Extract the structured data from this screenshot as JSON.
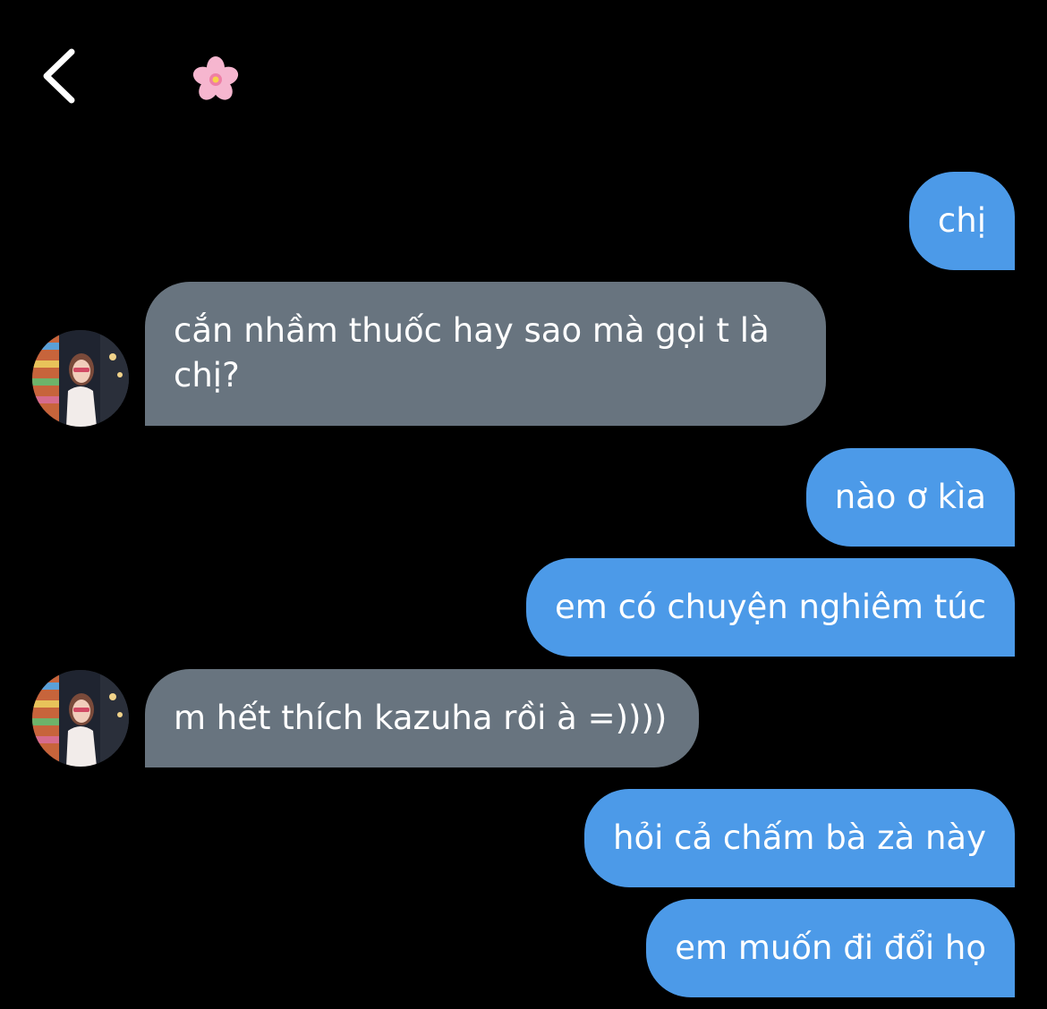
{
  "header": {
    "back_icon": "chevron-left-icon",
    "contact_icon": "cherry-blossom-icon"
  },
  "messages": [
    {
      "from": "me",
      "text": "chị"
    },
    {
      "from": "them",
      "text": "cắn nhầm thuốc hay sao mà gọi t là chị?"
    },
    {
      "from": "me",
      "text": "nào ơ kìa"
    },
    {
      "from": "me",
      "text": "em có chuyện nghiêm túc"
    },
    {
      "from": "them",
      "text": "m hết thích kazuha rồi à =))))"
    },
    {
      "from": "me",
      "text": "hỏi cả chấm bà zà này"
    },
    {
      "from": "me",
      "text": "em muốn đi đổi họ"
    }
  ],
  "colors": {
    "background": "#000000",
    "sent_bubble": "#4c9ae8",
    "received_bubble": "#68747f",
    "text": "#ffffff"
  }
}
